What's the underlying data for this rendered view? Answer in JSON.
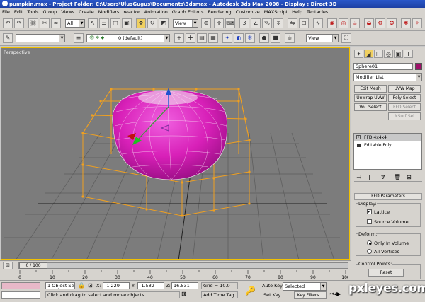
{
  "window": {
    "title": "pumpkin.max    - Project Folder: C:\\Users\\UlusGugus\\Documents\\3dsmax   - Autodesk 3ds Max 2008       - Display : Direct 3D"
  },
  "menu": [
    "File",
    "Edit",
    "Tools",
    "Group",
    "Views",
    "Create",
    "Modifiers",
    "reactor",
    "Animation",
    "Graph Editors",
    "Rendering",
    "Customize",
    "MAXScript",
    "Help",
    "Tentacles"
  ],
  "toolbar": {
    "filter_select": "All",
    "ref_coord_select": "View",
    "layer_select": "0 (default)",
    "view_select2": "View"
  },
  "viewport": {
    "label": "Perspective",
    "object_color": "#e020c0",
    "lattice_color": "#f0a020"
  },
  "command_panel": {
    "object_name": "Sphere01",
    "object_color": "#a0106a",
    "modifier_list": "Modifier List",
    "buttons": [
      "Edit Mesh",
      "UVW Map",
      "Unwrap UVW",
      "Poly Select",
      "Vol. Select",
      "FFD Select",
      "NSurf Sel"
    ],
    "stack": [
      "FFD 4x4x4",
      "Editable Poly"
    ],
    "rollout_title": "FFD Parameters",
    "display_group": "Display:",
    "lattice_label": "Lattice",
    "source_volume_label": "Source Volume",
    "deform_group": "Deform:",
    "only_in_volume_label": "Only In Volume",
    "all_vertices_label": "All Vertices",
    "control_points_group": "Control Points:",
    "reset_label": "Reset"
  },
  "timeline": {
    "frame_display": "0 / 100",
    "ticks": [
      "0",
      "10",
      "20",
      "30",
      "40",
      "50",
      "60",
      "70",
      "80",
      "90",
      "100"
    ],
    "current_frame": 0,
    "total_frames": 100
  },
  "status": {
    "selection": "1 Object Sele",
    "x_label": "X:",
    "x_value": "-1.229",
    "y_label": "Y:",
    "y_value": "-1.582",
    "z_label": "Z:",
    "z_value": "16.531",
    "grid": "Grid = 10.0",
    "prompt": "Click and drag to select and move objects",
    "add_time_tag": "Add Time Tag",
    "auto_key": "Auto Key",
    "auto_key_select": "Selected",
    "set_key": "Set Key",
    "key_filters": "Key Filters...",
    "frame_field": "0"
  },
  "watermark": "pxleyes.com"
}
